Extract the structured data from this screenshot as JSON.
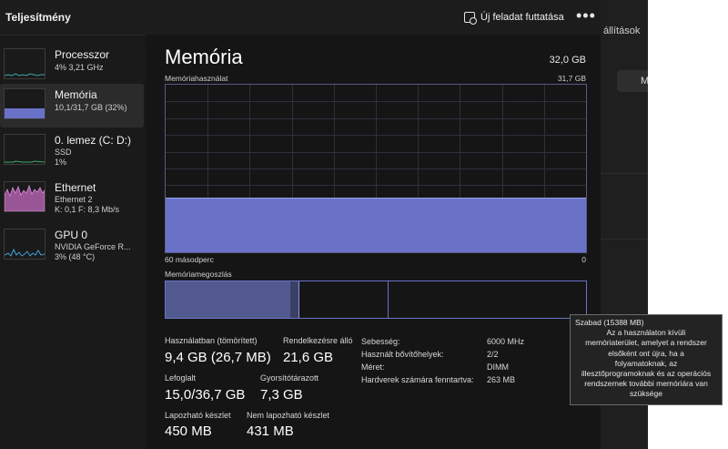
{
  "window": {
    "title": "Teljesítmény"
  },
  "toolbar": {
    "run_task_label": "Új feladat futtatása",
    "more_label": "•••"
  },
  "background_window": {
    "text": "állítások",
    "button_label": "M"
  },
  "sidebar": {
    "items": [
      {
        "name": "Processzor",
        "line1": "4%  3,21 GHz",
        "line2": "",
        "color": "#3fa7a7",
        "active": false
      },
      {
        "name": "Memória",
        "line1": "10,1/31,7 GB (32%)",
        "line2": "",
        "color": "#6a72c8",
        "active": true
      },
      {
        "name": "0. lemez (C: D:)",
        "line1": "SSD",
        "line2": "1%",
        "color": "#3fa86d",
        "active": false
      },
      {
        "name": "Ethernet",
        "line1": "Ethernet 2",
        "line2": "K: 0,1  F: 8,3 Mb/s",
        "color": "#c46bc1",
        "active": false
      },
      {
        "name": "GPU 0",
        "line1": "NVIDIA GeForce R...",
        "line2": "3% (48 °C)",
        "color": "#3f9fd6",
        "active": false
      }
    ]
  },
  "main": {
    "title": "Memória",
    "total": "32,0 GB",
    "usage_label": "Memóriahasználat",
    "usage_max": "31,7 GB",
    "usage_fill_fraction": 0.32,
    "time_left": "60 másodperc",
    "time_right": "0",
    "composition_label": "Memóriamegoszlás",
    "composition": {
      "in_use_fraction": 0.296,
      "modified_fraction": 0.02,
      "standby_end_fraction": 0.529
    },
    "stats": {
      "in_use_label": "Használatban (tömörített)",
      "in_use_value": "9,4 GB (26,7 MB)",
      "available_label": "Rendelkezésre álló",
      "available_value": "21,6 GB",
      "committed_label": "Lefoglalt",
      "committed_value": "15,0/36,7 GB",
      "cached_label": "Gyorsítótárazott",
      "cached_value": "7,3 GB",
      "paged_label": "Lapozható készlet",
      "paged_value": "450 MB",
      "nonpaged_label": "Nem lapozható készlet",
      "nonpaged_value": "431 MB"
    },
    "details": [
      {
        "key": "Sebesség:",
        "value": "6000 MHz"
      },
      {
        "key": "Használt bővítőhelyek:",
        "value": "2/2"
      },
      {
        "key": "Méret:",
        "value": "DIMM"
      },
      {
        "key": "Hardverek számára fenntartva:",
        "value": "263 MB"
      }
    ]
  },
  "tooltip": {
    "title": "Szabad (15388 MB)",
    "lines": [
      "Az a használaton kívüli",
      "memóriaterület, amelyet a rendszer",
      "elsőként ont újra, ha a",
      "folyamatoknak, az",
      "illesztőprogramoknak és az operációs",
      "rendszernek további memóriára van",
      "szüksége"
    ]
  }
}
